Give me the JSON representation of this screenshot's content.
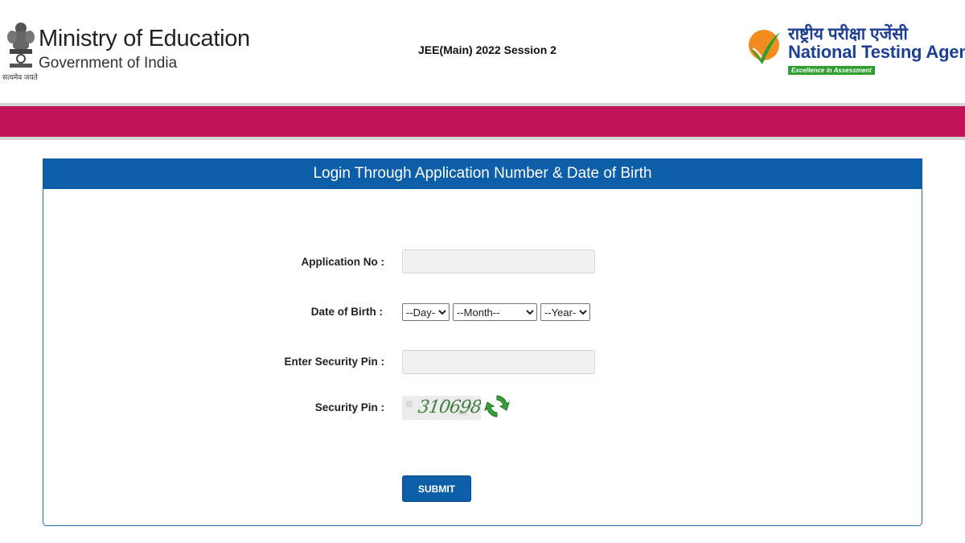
{
  "header": {
    "ministry_title": "Ministry of Education",
    "ministry_subtitle": "Government of India",
    "emblem_tagline": "सत्यमेव जयते",
    "exam_title": "JEE(Main) 2022 Session 2",
    "agency_hindi": "राष्ट्रीय परीक्षा एजेंसी",
    "agency_english": "National Testing Agency",
    "agency_tagline": "Excellence in Assessment"
  },
  "login": {
    "heading": "Login Through Application Number & Date of Birth",
    "application_label": "Application No :",
    "application_value": "",
    "dob_label": "Date of Birth :",
    "day_selected": "--Day--",
    "month_selected": "--Month--",
    "year_selected": "--Year--",
    "security_input_label": "Enter Security Pin :",
    "security_input_value": "",
    "security_pin_label": "Security Pin :",
    "captcha_text": "310698",
    "submit_label": "SUBMIT"
  },
  "colors": {
    "band": "#be1558",
    "primary": "#0d5ea8",
    "agency_blue": "#1d3f94",
    "agency_green": "#2e9f2e",
    "agency_orange": "#f28c1f"
  },
  "icons": {
    "emblem": "national-emblem-icon",
    "agency_logo": "nta-checkmark-logo",
    "refresh": "refresh-icon"
  }
}
